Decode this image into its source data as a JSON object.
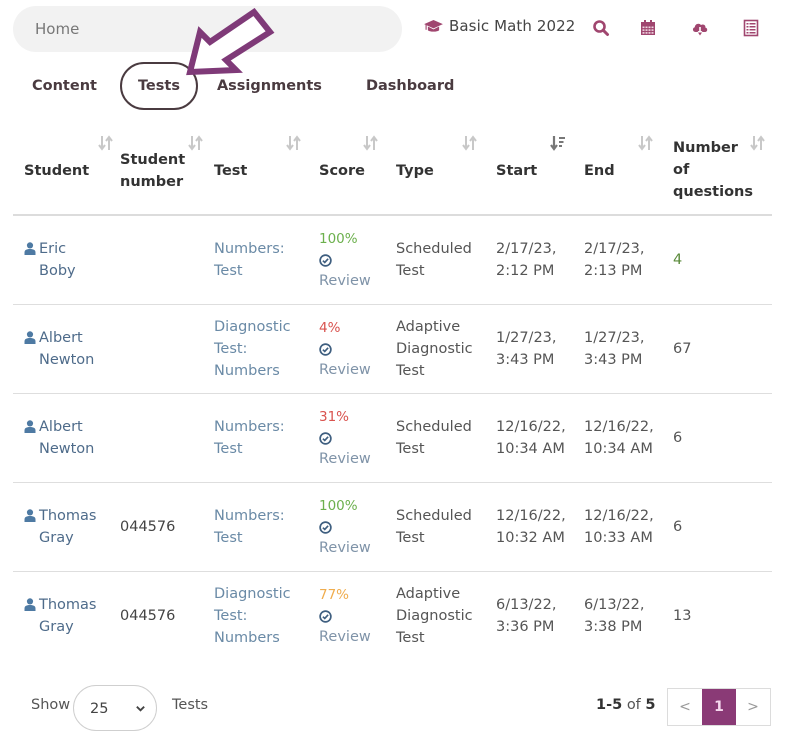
{
  "topbar": {
    "home_placeholder": "Home",
    "course_name": "Basic Math 2022",
    "icons": [
      "graduation-cap-icon",
      "search-icon",
      "calendar-icon",
      "cloud-download-icon",
      "list-icon"
    ],
    "accent_color": "#a0466f"
  },
  "tabs": [
    {
      "label": "Content",
      "active": false
    },
    {
      "label": "Tests",
      "active": true
    },
    {
      "label": "Assignments",
      "active": false
    },
    {
      "label": "Dashboard",
      "active": false
    }
  ],
  "table": {
    "columns": [
      {
        "label": "Student",
        "sort": "none"
      },
      {
        "label": "Student number",
        "sort": "none"
      },
      {
        "label": "Test",
        "sort": "none"
      },
      {
        "label": "Score",
        "sort": "none"
      },
      {
        "label": "Type",
        "sort": "none"
      },
      {
        "label": "Start",
        "sort": "descending"
      },
      {
        "label": "End",
        "sort": "none"
      },
      {
        "label": "Number of questions",
        "sort": "none"
      }
    ],
    "header_lines": {
      "student_number": [
        "Student",
        "number"
      ],
      "num_questions": [
        "Number",
        "of",
        "questions"
      ]
    },
    "review_label": "Review",
    "rows": [
      {
        "first": "Eric",
        "last": "Boby",
        "student_number": "",
        "test": [
          "Numbers:",
          "Test"
        ],
        "score": "100%",
        "score_color": "#6cb04d",
        "type": [
          "Scheduled",
          "Test"
        ],
        "start": [
          "2/17/23,",
          "2:12 PM"
        ],
        "end": [
          "2/17/23,",
          "2:13 PM"
        ],
        "questions": "4",
        "questions_color": "#5a8a3a"
      },
      {
        "first": "Albert",
        "last": "Newton",
        "student_number": "",
        "test": [
          "Diagnostic",
          "Test:",
          "Numbers"
        ],
        "score": "4%",
        "score_color": "#d9534f",
        "type": [
          "Adaptive",
          "Diagnostic",
          "Test"
        ],
        "start": [
          "1/27/23,",
          "3:43 PM"
        ],
        "end": [
          "1/27/23,",
          "3:43 PM"
        ],
        "questions": "67",
        "questions_color": "#555555"
      },
      {
        "first": "Albert",
        "last": "Newton",
        "student_number": "",
        "test": [
          "Numbers:",
          "Test"
        ],
        "score": "31%",
        "score_color": "#d9534f",
        "type": [
          "Scheduled",
          "Test"
        ],
        "start": [
          "12/16/22,",
          "10:34 AM"
        ],
        "end": [
          "12/16/22,",
          "10:34 AM"
        ],
        "questions": "6",
        "questions_color": "#555555"
      },
      {
        "first": "Thomas",
        "last": "Gray",
        "student_number": "044576",
        "test": [
          "Numbers:",
          "Test"
        ],
        "score": "100%",
        "score_color": "#6cb04d",
        "type": [
          "Scheduled",
          "Test"
        ],
        "start": [
          "12/16/22,",
          "10:32 AM"
        ],
        "end": [
          "12/16/22,",
          "10:33 AM"
        ],
        "questions": "6",
        "questions_color": "#555555"
      },
      {
        "first": "Thomas",
        "last": "Gray",
        "student_number": "044576",
        "test": [
          "Diagnostic",
          "Test:",
          "Numbers"
        ],
        "score": "77%",
        "score_color": "#f0ad4e",
        "type": [
          "Adaptive",
          "Diagnostic",
          "Test"
        ],
        "start": [
          "6/13/22,",
          "3:36 PM"
        ],
        "end": [
          "6/13/22,",
          "3:38 PM"
        ],
        "questions": "13",
        "questions_color": "#555555"
      }
    ]
  },
  "footer": {
    "show_label": "Show",
    "page_size": "25",
    "items_label": "Tests",
    "range_start_end": "1-5",
    "range_of": "of",
    "range_total": "5",
    "pager": {
      "prev": "<",
      "current": "1",
      "next": ">"
    },
    "active_page_color": "#8a3a76"
  }
}
